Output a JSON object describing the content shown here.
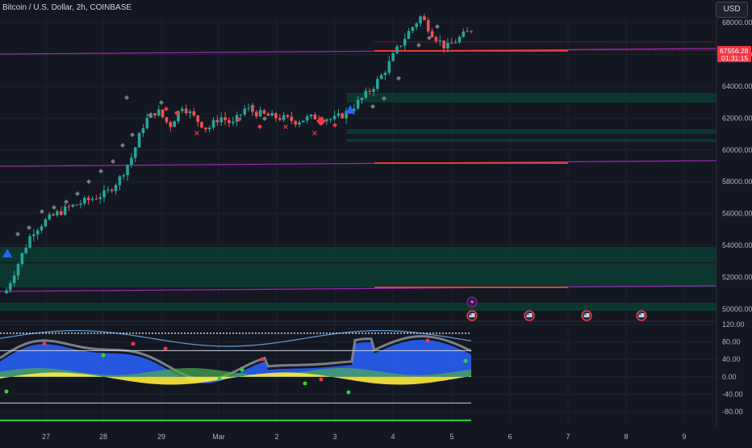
{
  "header": {
    "title": "Bitcoin / U.S. Dollar, 2h, COINBASE",
    "currency": "USD"
  },
  "price_tag": {
    "price": "67556.28",
    "countdown": "01:31:15",
    "color": "#f23645"
  },
  "colors": {
    "background": "#131722",
    "grid": "#1e222d",
    "up": "#26a69a",
    "down": "#ef5350",
    "upper_wick": "#b2b5be",
    "purple_line": "#9c27b0",
    "red_level": "#e53935",
    "zone": "#0b3d33",
    "osc_blue": "#2962ff",
    "osc_gray": "#9598a1",
    "osc_yellow": "#ffeb3b",
    "osc_green": "#4caf50",
    "lime": "#2fd62f"
  },
  "chart_data": [
    {
      "type": "candlestick",
      "title": "Bitcoin / U.S. Dollar, 2h, COINBASE",
      "y_axis_labels": [
        "68000.00",
        "66000.00",
        "64000.00",
        "62000.00",
        "60000.00",
        "58000.00",
        "56000.00",
        "54000.00",
        "52000.00",
        "50000.00"
      ],
      "y_ticks": [
        68000,
        66000,
        64000,
        62000,
        60000,
        58000,
        56000,
        54000,
        52000,
        50000
      ],
      "x_axis_labels": [
        "27",
        "28",
        "29",
        "Mar",
        "2",
        "3",
        "4",
        "5",
        "6",
        "7",
        "8",
        "9"
      ],
      "last_price": 67556.28,
      "close_series": [
        51200,
        53000,
        54800,
        55500,
        56000,
        56400,
        56700,
        57000,
        57300,
        58200,
        59600,
        61800,
        62500,
        61500,
        62800,
        62000,
        61300,
        62100,
        61600,
        62600,
        62300,
        62100,
        62000,
        61800,
        62000,
        62100,
        61900,
        62300,
        63000,
        63800,
        64800,
        66200,
        67400,
        68400,
        67200,
        66400,
        67000,
        67556
      ]
    },
    {
      "type": "area",
      "title": "",
      "y_axis_labels": [
        "120.00",
        "80.00",
        "40.00",
        "0.00",
        "-40.00",
        "-80.00"
      ],
      "y_ticks": [
        120,
        80,
        40,
        0,
        -40,
        -80
      ],
      "reference_levels": [
        100,
        60,
        -60,
        -100
      ]
    }
  ]
}
